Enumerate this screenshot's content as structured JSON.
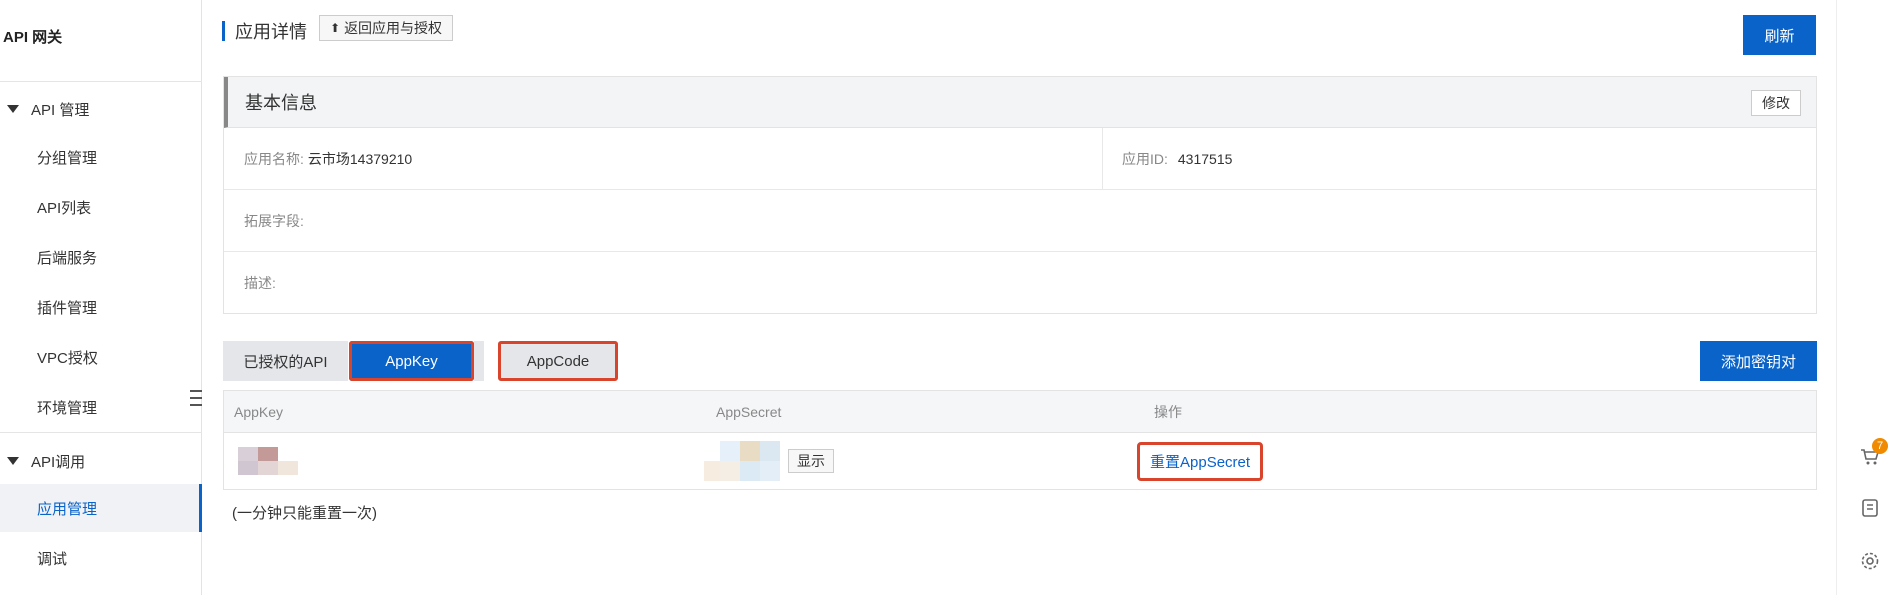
{
  "sidebar": {
    "title": "API 网关",
    "groups": [
      {
        "label": "API 管理",
        "items": [
          "分组管理",
          "API列表",
          "后端服务",
          "插件管理",
          "VPC授权",
          "环境管理"
        ]
      },
      {
        "label": "API调用",
        "items": [
          "应用管理",
          "调试"
        ]
      }
    ],
    "active_item": "应用管理"
  },
  "header": {
    "title": "应用详情",
    "back_label": "返回应用与授权",
    "refresh_label": "刷新"
  },
  "basic_info": {
    "title": "基本信息",
    "edit_label": "修改",
    "app_name_label": "应用名称:",
    "app_name_value": "云市场14379210",
    "app_id_label": "应用ID:",
    "app_id_value": "4317515",
    "ext_label": "拓展字段:",
    "desc_label": "描述:"
  },
  "tabs": [
    "已授权的API",
    "AppKey",
    "AppCode"
  ],
  "active_tab": "AppKey",
  "add_key_label": "添加密钥对",
  "table": {
    "columns": [
      "AppKey",
      "AppSecret",
      "操作"
    ],
    "row": {
      "show_label": "显示",
      "reset_label": "重置AppSecret"
    }
  },
  "note": "(一分钟只能重置一次)",
  "rail": {
    "cart_badge": "7",
    "icons": [
      "cart-icon",
      "api-doc-icon",
      "settings-icon"
    ]
  },
  "colors": {
    "primary": "#0a63c9",
    "highlight_border": "#d9452c",
    "badge": "#f08a00"
  }
}
